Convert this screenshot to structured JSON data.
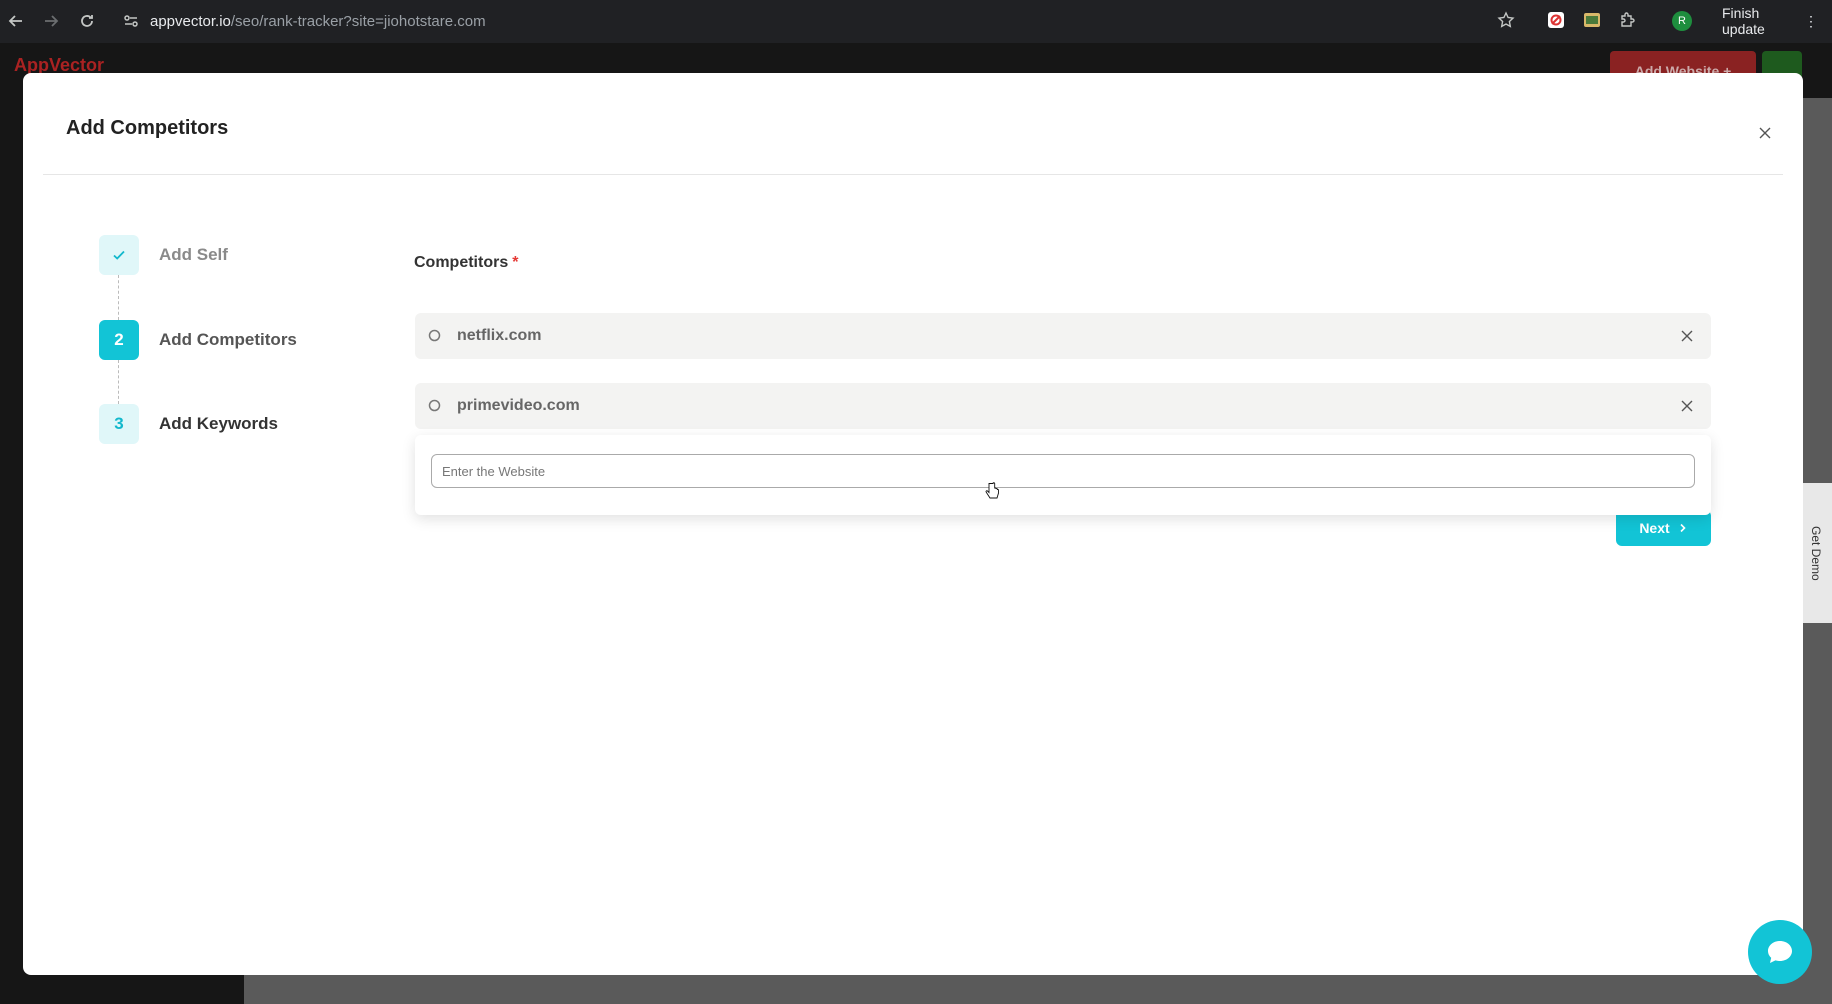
{
  "browser": {
    "url_host": "appvector.io",
    "url_path": "/seo/rank-tracker?site=jiohotstare.com",
    "profile_initial": "R",
    "finish_update_label": "Finish update"
  },
  "background_page": {
    "brand": "AppVector",
    "add_website_label": "Add Website +",
    "get_demo_label": "Get Demo"
  },
  "modal": {
    "title": "Add Competitors",
    "steps": [
      {
        "number": "✓",
        "label": "Add Self",
        "state": "done"
      },
      {
        "number": "2",
        "label": "Add Competitors",
        "state": "active"
      },
      {
        "number": "3",
        "label": "Add Keywords",
        "state": "pending"
      }
    ],
    "form": {
      "field_label": "Competitors",
      "required_mark": "*",
      "competitors": [
        "netflix.com",
        "primevideo.com"
      ],
      "website_input_placeholder": "Enter the Website",
      "website_input_value": "",
      "next_label": "Next"
    }
  },
  "colors": {
    "accent": "#12c4d6",
    "required": "#e53935"
  }
}
